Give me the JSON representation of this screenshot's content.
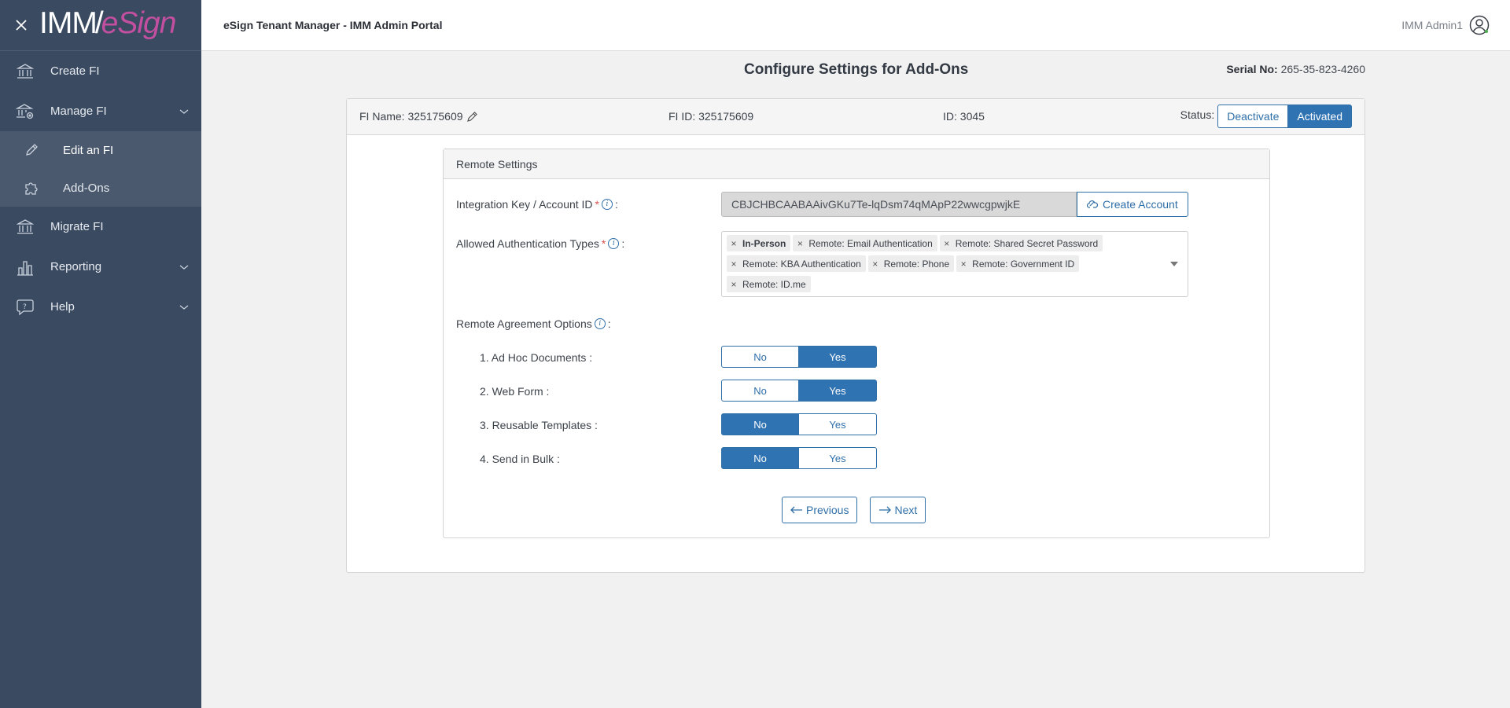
{
  "sidebar": {
    "logo": {
      "part1": "IMM",
      "part2": "eSign"
    },
    "items": [
      {
        "label": "Create FI",
        "icon": "bank-icon"
      },
      {
        "label": "Manage FI",
        "icon": "bank-gear-icon"
      },
      {
        "label": "Migrate FI",
        "icon": "bank-migrate-icon"
      },
      {
        "label": "Reporting",
        "icon": "bar-chart-icon"
      },
      {
        "label": "Help",
        "icon": "help-chat-icon"
      }
    ],
    "sub_items": [
      {
        "label": "Edit an FI",
        "icon": "pencil-icon"
      },
      {
        "label": "Add-Ons",
        "icon": "puzzle-icon"
      }
    ]
  },
  "header": {
    "title": "eSign Tenant Manager - IMM Admin Portal",
    "user": "IMM Admin1"
  },
  "page": {
    "title": "Configure Settings for Add-Ons",
    "serial_label": "Serial No:",
    "serial_value": "265-35-823-4260"
  },
  "fi": {
    "name": "FI Name: 325175609",
    "fi_id": "FI ID: 325175609",
    "id": "ID: 3045",
    "status_label": "Status:",
    "deactivate": "Deactivate",
    "activated": "Activated",
    "current_status": "Activated"
  },
  "remote": {
    "title": "Remote Settings",
    "integration_label": "Integration Key / Account ID",
    "integration_value": "CBJCHBCAABAAivGKu7Te-lqDsm74qMApP22wwcgpwjkE",
    "create_account": "Create Account",
    "auth_label": "Allowed Authentication Types",
    "auth_types": [
      "In-Person",
      "Remote: Email Authentication",
      "Remote: Shared Secret Password",
      "Remote: KBA Authentication",
      "Remote: Phone",
      "Remote: Government ID",
      "Remote: ID.me"
    ],
    "agreement_label": "Remote Agreement Options",
    "colon": ":",
    "no": "No",
    "yes": "Yes",
    "options": [
      {
        "label": "1. Ad Hoc Documents :",
        "value": "Yes"
      },
      {
        "label": "2. Web Form :",
        "value": "Yes"
      },
      {
        "label": "3. Reusable Templates :",
        "value": "No"
      },
      {
        "label": "4. Send in Bulk :",
        "value": "No"
      }
    ],
    "previous": "Previous",
    "next": "Next"
  },
  "colors": {
    "sidebar": "#3a4a60",
    "accent": "#2f73b3",
    "brand": "#c24fa0"
  }
}
